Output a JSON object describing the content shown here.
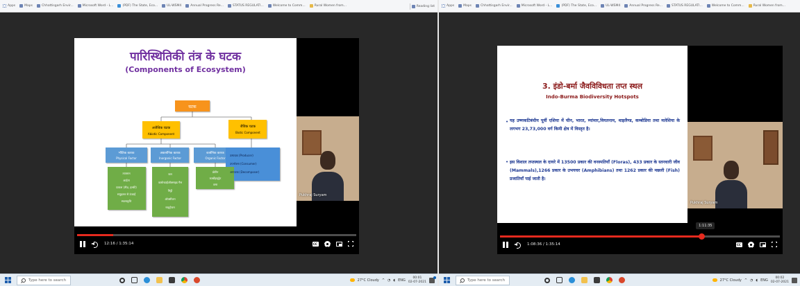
{
  "bookmarks_left": [
    "Apps",
    "Maps",
    "Chhattisgarh Envir...",
    "Microsoft Word - L...",
    "(PDF) The State, Eco...",
    "UL-WSM4",
    "Annual Progress Re...",
    "STATUS REGULATI...",
    "Welcome to Comm...",
    "Rural Women from..."
  ],
  "bookmarks_right": [
    "Apps",
    "Maps",
    "Chhattisgarh Envir...",
    "Microsoft Word - L...",
    "(PDF) The State, Eco...",
    "UL-WSM4",
    "Annual Progress Re...",
    "STATUS REGULATI...",
    "Welcome to Comm...",
    "Rural Women from..."
  ],
  "reading_list": "Reading list",
  "left_video": {
    "slide_title_hi": "पारिस्थितिकी तंत्र के घटक",
    "slide_title_en": "(Components of Ecosystem)",
    "root_box": "घटक",
    "abiotic_hi": "अजैविक घटक",
    "abiotic_en": "Abiotic Component",
    "biotic_hi": "जैविक घटक",
    "biotic_en": "Biotic Component",
    "physical_hi": "भौतिक कारक",
    "physical_en": "Physical Factor",
    "physical_items": [
      "तापमान",
      "आर्द्रता",
      "प्रकाश (तीव्र, हल्की)",
      "समुद्रतल से ऊंचाई",
      "स्थलाकृति"
    ],
    "inorganic_hi": "अकार्बनिक कारक",
    "inorganic_en": "Inorganic Factor",
    "inorganic_items": [
      "जल",
      "कार्बनडाईऑक्साइड गैस",
      "मिट्टी",
      "ऑक्सीजन",
      "नाइट्रोजन"
    ],
    "organic_hi": "कार्बनिक कारक",
    "organic_en": "Organic Factor",
    "organic_items": [
      "प्रोटीन",
      "कार्बोहाइड्रेट",
      "वसा"
    ],
    "biotic_items": [
      "उत्पादक (Producer)",
      "उपभोक्ता (Consumer)",
      "अपघटक (Decomposer)"
    ],
    "webcam_name": "Pukhraj Suryam",
    "time_text": "12:16 / 1:35:14",
    "progress": 0.129
  },
  "right_video": {
    "slide_title_hi": "3. इंडो-बर्मा जैवविविधता तप्त स्थल",
    "slide_title_en": "Indo-Burma Biodiversity Hotspots",
    "bullet1": "यह उष्णकटिबंधीय पूर्वी एशिया में चीन, भारत, म्यांमार,वियतनाम, थाइलैण्ड, कम्बोडिया तथा मलेशिया के लगभग 23,73,000 वर्ग किमी क्षेत्र में विस्तृत है।",
    "bullet2": "इस विशाल तप्तस्थल के दायरे में 13500 प्रकार की वनस्पतियाँ (Floras), 433 प्रकार के स्तनधारी जीव (Mammals),1266 प्रकार के उभयचर (Amphibians) तथा 1262 प्रकार की मछली (Fish) प्रजातियाँ पाई जाती है।",
    "webcam_name": "Pukhraj Suryam",
    "time_text": "1:08:36 / 1:35:14",
    "scrub_tooltip": "1:11:35",
    "progress": 0.72
  },
  "taskbar": {
    "search_placeholder": "Type here to search",
    "weather_left": "27°C Cloudy",
    "weather_right": "27°C Cloudy",
    "lang": "ENG",
    "time_left": "00:01",
    "date_left": "02-07-2021",
    "time_right": "00:02",
    "date_right": "02-07-2021"
  },
  "colors": {
    "red": "#e52a1e",
    "title_purple": "#7030a0",
    "orange": "#f7931e",
    "yellow": "#ffc000",
    "blue": "#5b9bd5",
    "green": "#70ad47",
    "maroon": "#8b1a1a",
    "navy": "#1f3a93"
  }
}
